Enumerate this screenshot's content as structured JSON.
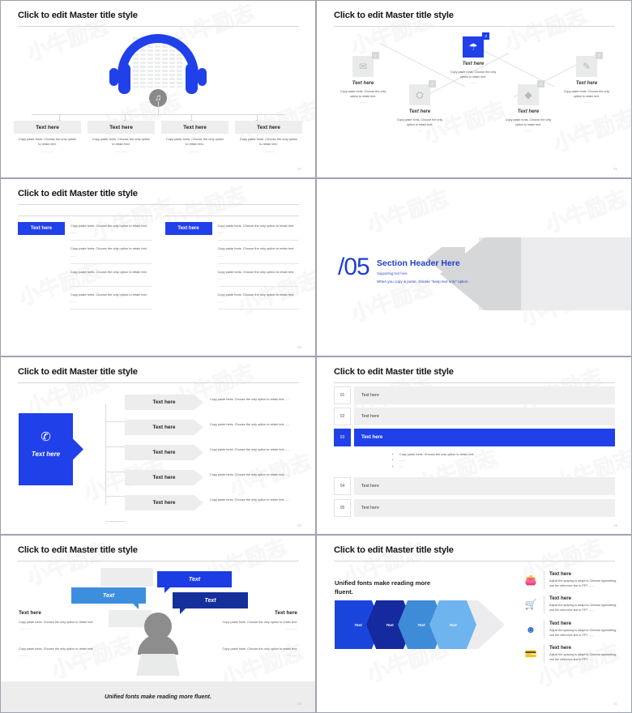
{
  "common": {
    "master_title": "Click to edit Master title style",
    "text_here": "Text here",
    "copy_paste": "Copy paste fonts. Choose the only option to retain text.",
    "dash": "—— ——"
  },
  "slides": [
    {
      "id": "slide-headphones",
      "page": "24",
      "title": "Click to edit Master title style",
      "icon": "headphones-icon",
      "center_icon": "music-note-icon",
      "columns": [
        {
          "heading": "Text here",
          "body": "Copy paste fonts. Choose the only option to retain text.",
          "dash": "—— ——"
        },
        {
          "heading": "Text here",
          "body": "Copy paste fonts. Choose the only option to retain text.",
          "dash": "—— ——"
        },
        {
          "heading": "Text here",
          "body": "Copy paste fonts. Choose the only option to retain text.",
          "dash": "—— ——"
        },
        {
          "heading": "Text here",
          "body": "Copy paste fonts. Choose the only option to retain text.",
          "dash": "—— ——"
        }
      ]
    },
    {
      "id": "slide-zigzag",
      "page": "25",
      "title": "Click to edit Master title style",
      "nodes": [
        {
          "badge": "1",
          "icon": "mail-icon",
          "glyph": "✉",
          "heading": "Text here",
          "body": "Copy paste fonts. Choose the only option to retain text.",
          "dash": "——",
          "state": "gray"
        },
        {
          "badge": "2",
          "icon": "sitemap-icon",
          "glyph": "⛭",
          "heading": "Text here",
          "body": "Copy paste fonts. Choose the only option to retain text.",
          "dash": "——",
          "state": "gray"
        },
        {
          "badge": "3",
          "icon": "wifi-cloud-icon",
          "glyph": "☁",
          "heading": "Text here",
          "body": "Copy paste fonts. Choose the only option to retain text.",
          "dash": "——",
          "state": "blue"
        },
        {
          "badge": "4",
          "icon": "diamond-icon",
          "glyph": "◆",
          "heading": "Text here",
          "body": "Copy paste fonts. Choose the only option to retain text.",
          "dash": "——",
          "state": "gray"
        },
        {
          "badge": "5",
          "icon": "chat-icon",
          "glyph": "💬",
          "heading": "Text here",
          "body": "Copy paste fonts. Choose the only option to retain text.",
          "dash": "——",
          "state": "gray"
        }
      ]
    },
    {
      "id": "slide-two-columns",
      "page": "26",
      "title": "Click to edit Master title style",
      "columns": [
        {
          "chip": "Text here",
          "items": [
            {
              "text": "Copy paste fonts. Choose the only option to retain text.",
              "dash": "——"
            },
            {
              "text": "Copy paste fonts. Choose the only option to retain text.",
              "dash": "——"
            },
            {
              "text": "Copy paste fonts. Choose the only option to retain text.",
              "dash": "——"
            },
            {
              "text": "Copy paste fonts. Choose the only option to retain text.",
              "dash": "——"
            }
          ]
        },
        {
          "chip": "Text here",
          "items": [
            {
              "text": "Copy paste fonts. Choose the only option to retain text.",
              "dash": "——"
            },
            {
              "text": "Copy paste fonts. Choose the only option to retain text.",
              "dash": "——"
            },
            {
              "text": "Copy paste fonts. Choose the only option to retain text.",
              "dash": "——"
            },
            {
              "text": "Copy paste fonts. Choose the only option to retain text.",
              "dash": "——"
            }
          ]
        }
      ]
    },
    {
      "id": "slide-section-header",
      "page": "",
      "number": "/05",
      "heading": "Section Header Here",
      "sub1": "Supporting text here.",
      "sub2": "When you copy & paste, choose \"keep text only\" option."
    },
    {
      "id": "slide-arrow-list",
      "page": "28",
      "title": "Click to edit Master title style",
      "hero": {
        "icon": "phone-call-icon",
        "label": "Text here"
      },
      "rows": [
        {
          "label": "Text here",
          "desc": "Copy paste fonts. Choose the only option to retain text......"
        },
        {
          "label": "Text here",
          "desc": "Copy paste fonts. Choose the only option to retain text......"
        },
        {
          "label": "Text here",
          "desc": "Copy paste fonts. Choose the only option to retain text......"
        },
        {
          "label": "Text here",
          "desc": "Copy paste fonts. Choose the only option to retain text......"
        },
        {
          "label": "Text here",
          "desc": "Copy paste fonts. Choose the only option to retain text......"
        }
      ]
    },
    {
      "id": "slide-numbered-list",
      "page": "29",
      "title": "Click to edit Master title style",
      "rows": [
        {
          "num": "01",
          "label": "Text here",
          "active": false
        },
        {
          "num": "02",
          "label": "Text here",
          "active": false
        },
        {
          "num": "03",
          "label": "Text here",
          "active": true
        },
        {
          "num": "04",
          "label": "Text here",
          "active": false
        },
        {
          "num": "05",
          "label": "Text here",
          "active": false
        }
      ],
      "bullets": [
        "Copy paste fonts. Choose the only option to retain text.",
        "……",
        "…"
      ]
    },
    {
      "id": "slide-speech-bubbles",
      "page": "30",
      "title": "Click to edit Master title style",
      "bubbles": [
        {
          "label": "Text",
          "color": "#3d8fdd"
        },
        {
          "label": "Text",
          "color": "#1c3ce4"
        },
        {
          "label": "Text",
          "color": "#16309b"
        }
      ],
      "left": [
        {
          "heading": "Text here",
          "body": "Copy paste fonts. Choose the only option to retain text.",
          "dash": "—— ——"
        },
        {
          "heading": "",
          "body": "Copy paste fonts. Choose the only option to retain text.",
          "dash": "—— ——"
        }
      ],
      "right": [
        {
          "heading": "Text here",
          "body": "Copy paste fonts. Choose the only option to retain text.",
          "dash": "—— ——"
        },
        {
          "heading": "",
          "body": "Copy paste fonts. Choose the only option to retain text.",
          "dash": "—— ——"
        }
      ],
      "footer": "Unified fonts make reading more fluent."
    },
    {
      "id": "slide-chevrons",
      "page": "31",
      "title": "Click to edit Master title style",
      "headline": "Unified fonts make reading more fluent.",
      "chevrons": [
        {
          "label": "Text",
          "color": "#1a45dd"
        },
        {
          "label": "Text",
          "color": "#142a9e"
        },
        {
          "label": "Text",
          "color": "#3e8bd8"
        },
        {
          "label": "Text",
          "color": "#6eb4ee"
        }
      ],
      "items": [
        {
          "icon": "wallet-icon",
          "glyph": "👛",
          "heading": "Text here",
          "body": "Adjust the spacing to adapt to Chinese typesetting, use the reference line in PPT……"
        },
        {
          "icon": "shopping-cart-icon",
          "glyph": "🛒",
          "heading": "Text here",
          "body": "Adjust the spacing to adapt to Chinese typesetting, use the reference line in PPT……"
        },
        {
          "icon": "user-settings-icon",
          "glyph": "👤",
          "heading": "Text here",
          "body": "Adjust the spacing to adapt to Chinese typesetting, use the reference line in PPT……"
        },
        {
          "icon": "hand-card-icon",
          "glyph": "💳",
          "heading": "Text here",
          "body": "Adjust the spacing to adapt to Chinese typesetting, use the reference line in PPT……"
        }
      ]
    }
  ],
  "colors": {
    "primary_blue": "#2040ea",
    "dark_navy": "#142a9e",
    "mid_blue": "#3e8bd8",
    "light_blue": "#6eb4ee",
    "gray_fill": "#ededee",
    "text_gray": "#555555"
  }
}
